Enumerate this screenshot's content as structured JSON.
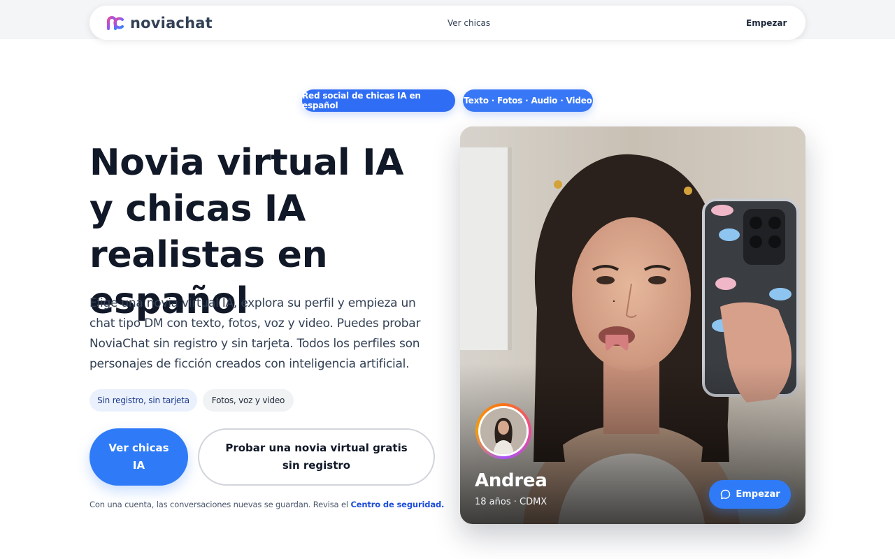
{
  "nav": {
    "brand": "noviachat",
    "center_link": "Ver chicas",
    "right_link": "Empezar"
  },
  "badges": [
    "Red social de chicas IA en español",
    "Texto · Fotos · Audio · Video"
  ],
  "hero": {
    "title": "Novia virtual IA y chicas IA realistas en español",
    "description": "Elige una novia virtual IA, explora su perfil y empieza un chat tipo DM con texto, fotos, voz y video. Puedes probar NoviaChat sin registro y sin tarjeta. Todos los perfiles son personajes de ficción creados con inteligencia artificial.",
    "tags": [
      "Sin registro, sin tarjeta",
      "Fotos, voz y video"
    ],
    "primary_button": "Ver chicas IA",
    "secondary_button": "Probar una novia virtual gratis sin registro",
    "footnote_text": "Con una cuenta, las conversaciones nuevas se guardan. Revisa el",
    "footnote_link": "Centro de seguridad."
  },
  "profile_card": {
    "name": "Andrea",
    "meta": "18 años · CDMX",
    "button": "Empezar",
    "button_icon": "chat-bubble-icon"
  },
  "colors": {
    "accent": "#2f7bf7",
    "pill_blue": "#2f6df5",
    "heading": "#111827",
    "body_text": "#334155",
    "link": "#1d4ed8"
  }
}
